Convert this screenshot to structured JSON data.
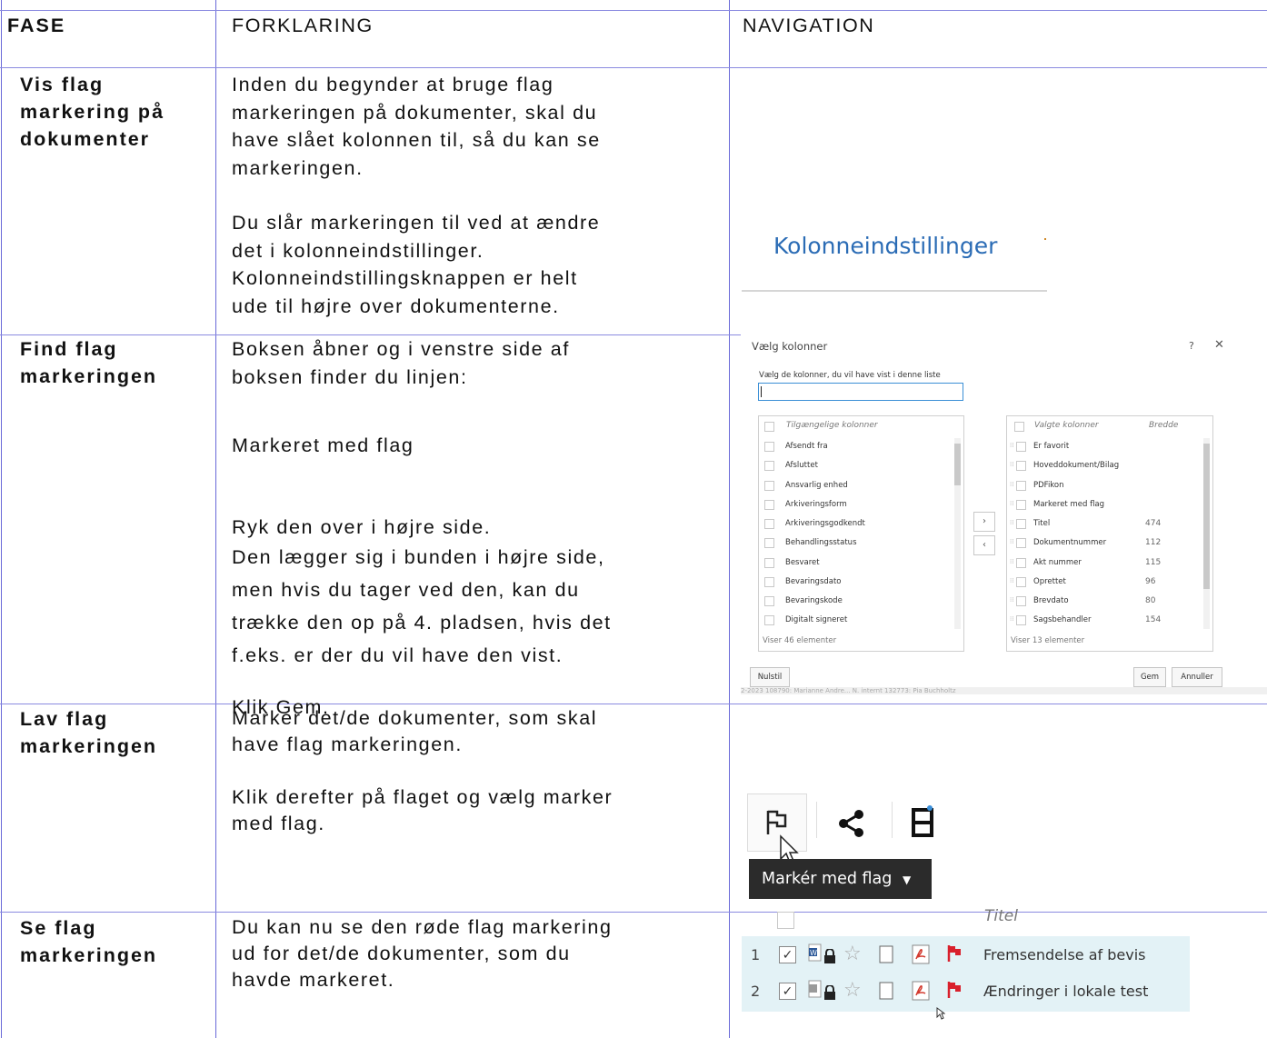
{
  "header": {
    "fase": "FASE",
    "forklaring": "FORKLARING",
    "navigation": "NAVIGATION"
  },
  "rows": [
    {
      "fase": [
        "Vis flag",
        "markering på",
        "dokumenter"
      ],
      "text1": [
        "Inden du begynder at bruge flag",
        "markeringen på dokumenter, skal du",
        "have slået kolonnen til, så du kan se",
        "markeringen."
      ],
      "text2": [
        "Du slår markeringen til ved at ændre",
        "det i kolonneindstillinger.",
        "Kolonneindstillingsknappen er helt",
        "ude til højre over dokumenterne."
      ],
      "nav_link": "Kolonneindstillinger"
    },
    {
      "fase": [
        "Find flag",
        "markeringen"
      ],
      "text1": [
        "Boksen åbner og i venstre side af",
        "boksen finder du linjen:"
      ],
      "text2": [
        "Markeret med flag"
      ],
      "text3": [
        "Ryk den over i højre side.",
        "Den lægger sig i bunden i højre side,",
        "men hvis du tager ved den, kan du",
        "trække den op på 4. pladsen, hvis det",
        "f.eks. er der du vil have den vist."
      ],
      "text4": [
        "Klik Gem."
      ]
    },
    {
      "fase": [
        "Lav flag",
        "markeringen"
      ],
      "text1": [
        "Marker det/de dokumenter, som skal",
        "have flag markeringen."
      ],
      "text2": [
        "Klik derefter på flaget og vælg marker",
        "med flag."
      ],
      "tooltip": "Markér med flag"
    },
    {
      "fase": [
        "Se flag",
        "markeringen"
      ],
      "text1": [
        "Du kan nu se den røde flag markering",
        "ud for det/de dokumenter, som du",
        "havde markeret."
      ]
    }
  ],
  "dialog": {
    "title": "Vælg kolonner",
    "help": "?",
    "close": "✕",
    "subtitle": "Vælg de kolonner, du vil have vist i denne liste",
    "available_header": "Tilgængelige kolonner",
    "available": [
      "Afsendt fra",
      "Afsluttet",
      "Ansvarlig enhed",
      "Arkiveringsform",
      "Arkiveringsgodkendt",
      "Behandlingsstatus",
      "Besvaret",
      "Bevaringsdato",
      "Bevaringskode",
      "Digitalt signeret"
    ],
    "available_footer": "Viser 46 elementer",
    "selected_header": "Valgte kolonner",
    "width_header": "Bredde",
    "selected": [
      {
        "name": "Er favorit",
        "width": ""
      },
      {
        "name": "Hoveddokument/Bilag",
        "width": ""
      },
      {
        "name": "PDFikon",
        "width": ""
      },
      {
        "name": "Markeret med flag",
        "width": ""
      },
      {
        "name": "Titel",
        "width": "474"
      },
      {
        "name": "Dokumentnummer",
        "width": "112"
      },
      {
        "name": "Akt nummer",
        "width": "115"
      },
      {
        "name": "Oprettet",
        "width": "96"
      },
      {
        "name": "Brevdato",
        "width": "80"
      },
      {
        "name": "Sagsbehandler",
        "width": "154"
      }
    ],
    "selected_footer": "Viser 13 elementer",
    "move_right": "›",
    "move_left": "‹",
    "reset": "Nulstil",
    "save": "Gem",
    "cancel": "Annuller",
    "bg_row": "2-2023   108790: Marianne Andre...                               N. internt        132773: Pia Buchholtz"
  },
  "list": {
    "header": "Titel",
    "items": [
      {
        "num": "1",
        "title": "Fremsendelse af bevis"
      },
      {
        "num": "2",
        "title": "Ændringer i lokale test"
      }
    ]
  },
  "colors": {
    "grid": "#6a6ad8",
    "link": "#2b6cb5",
    "flag": "#d9202c",
    "pdf": "#d33a2f",
    "tooltip_bg": "#2b2b2b",
    "list_bg": "#e3f2f6"
  }
}
